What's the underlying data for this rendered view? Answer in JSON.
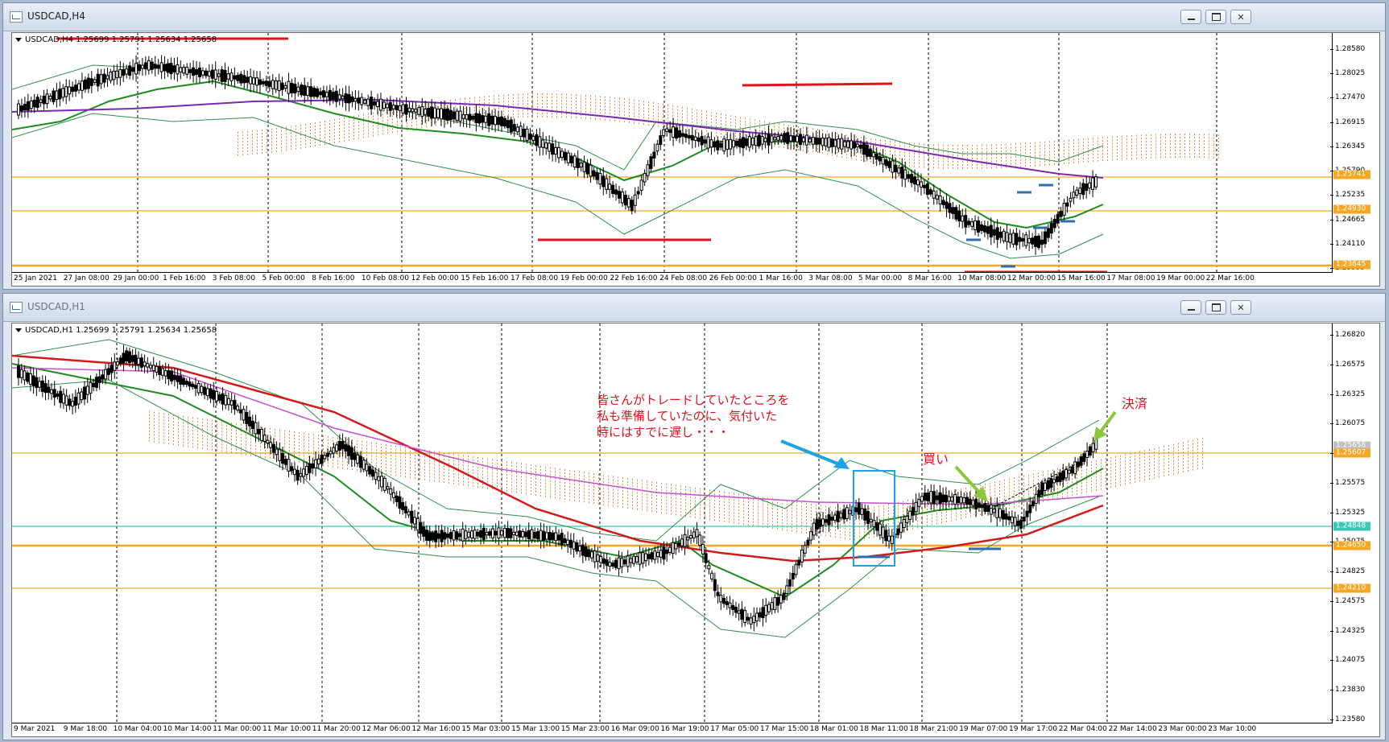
{
  "colors": {
    "bull_candle": "#ffffff",
    "bear_candle": "#000000",
    "ma_fast": "#1e8c1e",
    "ma_slow": "#7a28b4",
    "ma_200": "#d31a1a",
    "bollinger": "#2f8f4e",
    "kumo": "#e08a3c",
    "level_line": "#f5a623",
    "annotation_red": "#e0121b",
    "arrow_blue": "#1aa3e6",
    "arrow_green": "#8cc63f",
    "box_blue": "#1aa3e6"
  },
  "top_window": {
    "title": "USDCAD,H4",
    "chart_label": "USDCAD,H4  1.25699 1.25791 1.25634 1.25658",
    "y_ticks": [
      "1.28580",
      "1.28025",
      "1.27470",
      "1.26915",
      "1.26345",
      "1.25790",
      "1.25235",
      "1.24665",
      "1.24110",
      "1.23555"
    ],
    "price_tags": [
      {
        "text": "1.25741",
        "color": "#f5a623"
      },
      {
        "text": "1.24930",
        "color": "#f5a623"
      },
      {
        "text": "1.23645",
        "color": "#f5a623"
      }
    ],
    "x_ticks": [
      "25 Jan 2021",
      "27 Jan 08:00",
      "29 Jan 00:00",
      "1 Feb 16:00",
      "3 Feb 08:00",
      "5 Feb 00:00",
      "8 Feb 16:00",
      "10 Feb 08:00",
      "12 Feb 00:00",
      "15 Feb 16:00",
      "17 Feb 08:00",
      "19 Feb 00:00",
      "22 Feb 16:00",
      "24 Feb 08:00",
      "26 Feb 00:00",
      "1 Mar 16:00",
      "3 Mar 08:00",
      "5 Mar 00:00",
      "8 Mar 16:00",
      "10 Mar 08:00",
      "12 Mar 00:00",
      "15 Mar 16:00",
      "17 Mar 08:00",
      "19 Mar 00:00",
      "22 Mar 16:00"
    ]
  },
  "bottom_window": {
    "title": "USDCAD,H1",
    "chart_label": "USDCAD,H1  1.25699 1.25791 1.25634 1.25658",
    "y_ticks": [
      "1.26820",
      "1.26575",
      "1.26325",
      "1.26075",
      "1.25825",
      "1.25575",
      "1.25325",
      "1.25075",
      "1.24825",
      "1.24575",
      "1.24325",
      "1.24075",
      "1.23830",
      "1.23580"
    ],
    "price_tags": [
      {
        "text": "1.25658",
        "color": "#c0c0c0"
      },
      {
        "text": "1.25607",
        "color": "#f5a623"
      },
      {
        "text": "1.24848",
        "color": "#3cc7b4"
      },
      {
        "text": "1.24650",
        "color": "#f5a623"
      },
      {
        "text": "1.24210",
        "color": "#f5a623"
      }
    ],
    "x_ticks": [
      "9 Mar 2021",
      "9 Mar 18:00",
      "10 Mar 04:00",
      "10 Mar 14:00",
      "11 Mar 00:00",
      "11 Mar 10:00",
      "11 Mar 20:00",
      "12 Mar 06:00",
      "12 Mar 16:00",
      "15 Mar 03:00",
      "15 Mar 13:00",
      "15 Mar 23:00",
      "16 Mar 09:00",
      "16 Mar 19:00",
      "17 Mar 05:00",
      "17 Mar 15:00",
      "18 Mar 01:00",
      "18 Mar 11:00",
      "18 Mar 21:00",
      "19 Mar 07:00",
      "19 Mar 17:00",
      "22 Mar 04:00",
      "22 Mar 14:00",
      "23 Mar 00:00",
      "23 Mar 10:00"
    ],
    "annotations": {
      "comment_line1": "皆さんがトレードしていたところを",
      "comment_line2": "私も準備していたのに、気付いた",
      "comment_line3": "時にはすでに遅し・・・",
      "buy_label": "買い",
      "settle_label": "決済"
    }
  }
}
